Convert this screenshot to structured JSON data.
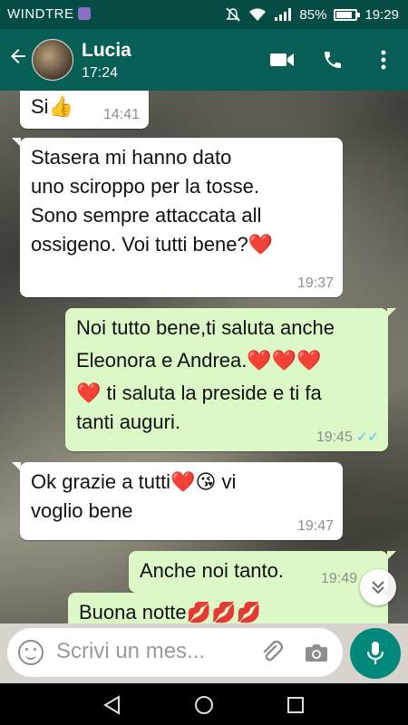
{
  "status": {
    "carrier": "WINDTRE",
    "battery": "85%",
    "battery_level": 0.85,
    "time": "19:29"
  },
  "header": {
    "name": "Lucia",
    "subtitle": "17:24"
  },
  "messages": [
    {
      "dir": "in",
      "text": "Si👍",
      "time": "14:41"
    },
    {
      "dir": "in",
      "lines": [
        "Stasera mi hanno dato",
        "uno sciroppo per la tosse.",
        "Sono sempre attaccata all",
        "ossigeno. Voi tutti bene?❤️"
      ],
      "time": "19:37"
    },
    {
      "dir": "out",
      "lines": [
        "Noi tutto bene,ti saluta anche",
        "Eleonora e Andrea.❤️❤️❤️",
        "❤️ ti saluta la preside e ti fa",
        "tanti auguri."
      ],
      "time": "19:45",
      "read": "✓✓"
    },
    {
      "dir": "in",
      "lines": [
        "Ok grazie a tutti❤️😘 vi",
        "voglio bene"
      ],
      "time": "19:47"
    },
    {
      "dir": "out",
      "text": "Anche noi tanto.",
      "time": "19:49"
    },
    {
      "dir": "out",
      "text": "Buona notte💋💋💋"
    }
  ],
  "composer": {
    "placeholder": "Scrivi un mes..."
  },
  "colors": {
    "header": "#075e54",
    "status_bar": "#054d44",
    "outgoing": "#dcf8c6",
    "incoming": "#ffffff",
    "accent": "#00897b",
    "read_ticks": "#4fc3f7"
  },
  "icons": {
    "back": "arrow-left-icon",
    "video": "video-camera-icon",
    "call": "phone-icon",
    "menu": "kebab-menu-icon",
    "emoji": "emoji-icon",
    "attach": "paperclip-icon",
    "camera": "camera-icon",
    "mic": "microphone-icon",
    "scroll": "double-chevron-down-icon"
  }
}
